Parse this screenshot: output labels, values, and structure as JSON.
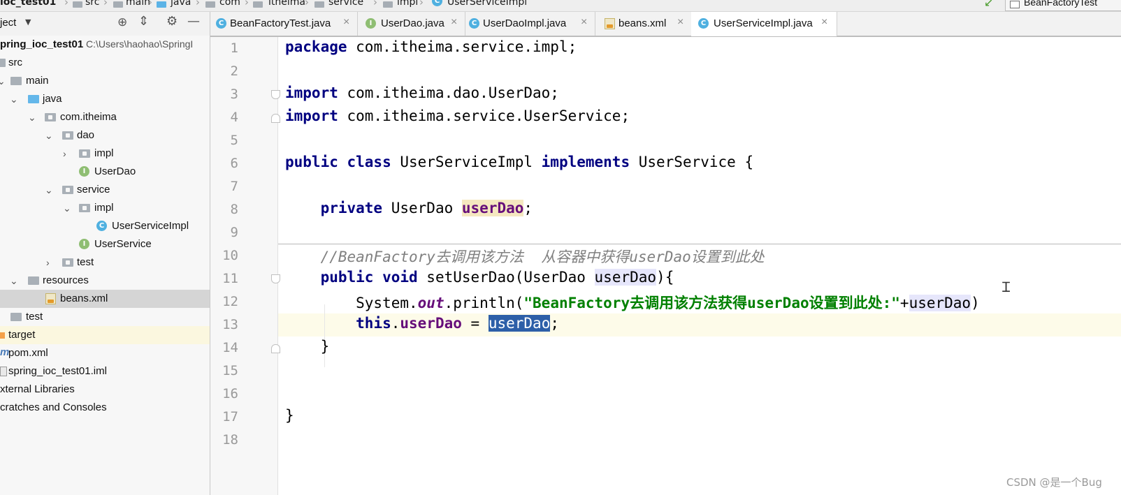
{
  "breadcrumb": [
    "ioc_test01",
    "src",
    "main",
    "java",
    "com",
    "itheima",
    "service",
    "impl",
    "UserServiceImpl"
  ],
  "run_config": "BeanFactoryTest",
  "project_panel": {
    "title": "ject",
    "tree": [
      {
        "label": "pring_ioc_test01",
        "path": "C:\\Users\\haohao\\SpringI"
      },
      {
        "label": "src"
      },
      {
        "label": "main"
      },
      {
        "label": "java"
      },
      {
        "label": "com.itheima"
      },
      {
        "label": "dao"
      },
      {
        "label": "impl"
      },
      {
        "label": "UserDao"
      },
      {
        "label": "service"
      },
      {
        "label": "impl"
      },
      {
        "label": "UserServiceImpl"
      },
      {
        "label": "UserService"
      },
      {
        "label": "test"
      },
      {
        "label": "resources"
      },
      {
        "label": "beans.xml"
      },
      {
        "label": "test"
      },
      {
        "label": "target"
      },
      {
        "label": "pom.xml"
      },
      {
        "label": "spring_ioc_test01.iml"
      },
      {
        "label": "xternal Libraries"
      },
      {
        "label": "cratches and Consoles"
      }
    ]
  },
  "tabs": [
    {
      "label": "BeanFactoryTest.java",
      "icon": "class-icon"
    },
    {
      "label": "UserDao.java",
      "icon": "interface-icon"
    },
    {
      "label": "UserDaoImpl.java",
      "icon": "class-icon"
    },
    {
      "label": "beans.xml",
      "icon": "xml-icon"
    },
    {
      "label": "UserServiceImpl.java",
      "icon": "class-icon",
      "active": true
    }
  ],
  "tab_close_glyph": "×",
  "editor": {
    "line_numbers": [
      "1",
      "2",
      "3",
      "4",
      "5",
      "6",
      "7",
      "8",
      "9",
      "10",
      "11",
      "12",
      "13",
      "14",
      "15",
      "16",
      "17",
      "18"
    ],
    "current_line": 13,
    "lines": [
      [
        {
          "t": "package",
          "c": "kw"
        },
        {
          "t": " com.itheima.service.impl;"
        }
      ],
      [],
      [
        {
          "t": "import",
          "c": "kw"
        },
        {
          "t": " com.itheima.dao.UserDao;"
        }
      ],
      [
        {
          "t": "import",
          "c": "kw"
        },
        {
          "t": " com.itheima.service.UserService;"
        }
      ],
      [],
      [
        {
          "t": "public class",
          "c": "kw"
        },
        {
          "t": " UserServiceImpl "
        },
        {
          "t": "implements",
          "c": "kw"
        },
        {
          "t": " UserService {"
        }
      ],
      [],
      [
        {
          "t": "    "
        },
        {
          "t": "private",
          "c": "kw"
        },
        {
          "t": " UserDao "
        },
        {
          "t": "userDao",
          "c": "field hl-yellow"
        },
        {
          "t": ";"
        }
      ],
      [],
      [
        {
          "t": "    "
        },
        {
          "t": "//BeanFactory去调用该方法  从容器中获得userDao设置到此处",
          "c": "cmt"
        }
      ],
      [
        {
          "t": "    "
        },
        {
          "t": "public void",
          "c": "kw"
        },
        {
          "t": " setUserDao(UserDao "
        },
        {
          "t": "userDao",
          "c": "hl-ref"
        },
        {
          "t": "){"
        }
      ],
      [
        {
          "t": "        System."
        },
        {
          "t": "out",
          "c": "static"
        },
        {
          "t": ".println("
        },
        {
          "t": "\"BeanFactory去调用该方法获得userDao设置到此处:\"",
          "c": "str"
        },
        {
          "t": "+"
        },
        {
          "t": "userDao",
          "c": "hl-ref"
        },
        {
          "t": ")"
        }
      ],
      [
        {
          "t": "        "
        },
        {
          "t": "this",
          "c": "kw"
        },
        {
          "t": "."
        },
        {
          "t": "userDao",
          "c": "field"
        },
        {
          "t": " = "
        },
        {
          "t": "userDao",
          "c": "hl-sel"
        },
        {
          "t": ";"
        }
      ],
      [
        {
          "t": "    }"
        }
      ],
      [],
      [],
      [
        {
          "t": "}"
        }
      ],
      []
    ]
  },
  "watermark": "CSDN @是一个Bug"
}
